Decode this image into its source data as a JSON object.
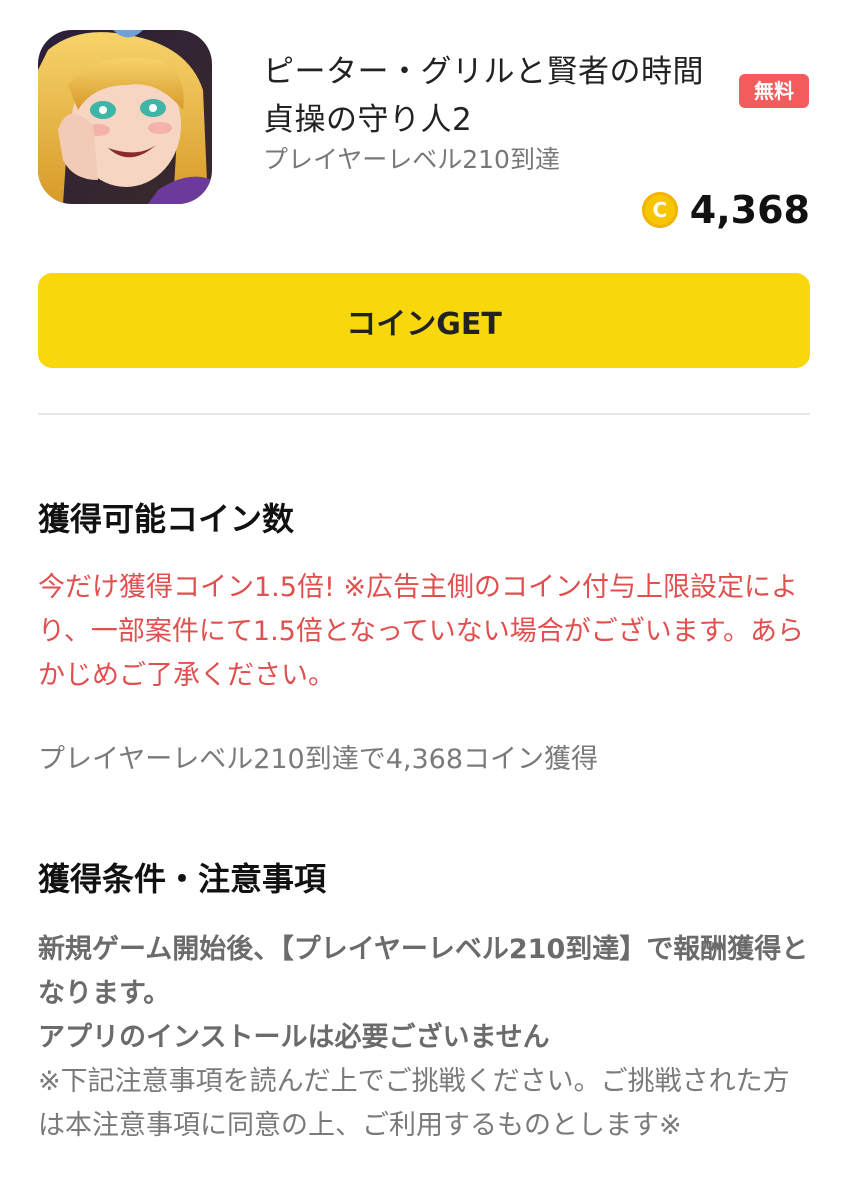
{
  "app": {
    "title_line1": "ピーター・グリルと賢者の時間",
    "title_line2": "貞操の守り人2",
    "subtitle": "プレイヤーレベル210到達",
    "free_badge": "無料",
    "coin_symbol": "C",
    "coin_amount": "4,368"
  },
  "cta": {
    "label": "コインGET"
  },
  "reward_section": {
    "heading": "獲得可能コイン数",
    "campaign_notice": "今だけ獲得コイン1.5倍! ※広告主側のコイン付与上限設定により、一部案件にて1.5倍となっていない場合がございます。あらかじめご了承ください。",
    "reward_summary": "プレイヤーレベル210到達で4,368コイン獲得"
  },
  "conditions_section": {
    "heading": "獲得条件・注意事項",
    "condition_line1": "新規ゲーム開始後、【プレイヤーレベル210到達】で報酬獲得となります。",
    "condition_line2": "アプリのインストールは必要ございません",
    "note": "※下記注意事項を読んだ上でご挑戦ください。ご挑戦された方は本注意事項に同意の上、ご利用するものとします※"
  },
  "colors": {
    "accent_yellow": "#f8d80a",
    "badge_red": "#f25c5c",
    "notice_red": "#e0504f",
    "coin_gold": "#f7c600"
  },
  "icons": {
    "app_icon": "anime-character-app-icon",
    "coin": "coin-icon"
  }
}
